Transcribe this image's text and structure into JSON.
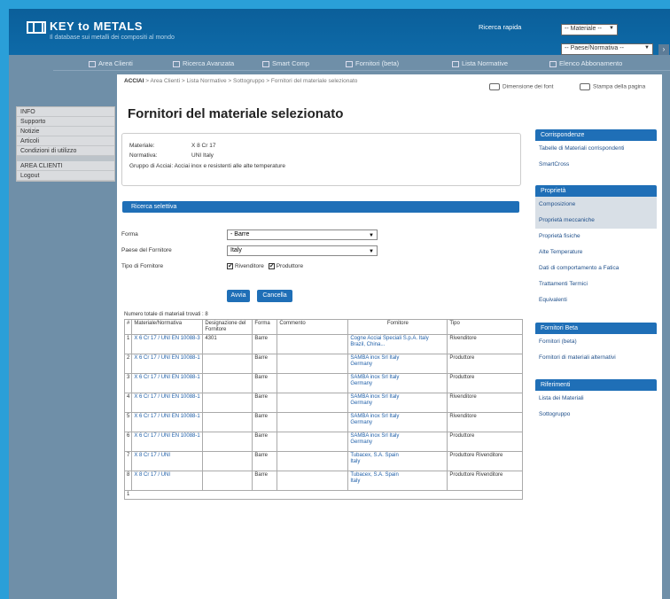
{
  "header": {
    "logo_text": "KEY to METALS",
    "tagline": "Il database sui metalli dei compositi al mondo",
    "quick_search_label": "Ricerca rapida",
    "material_select": "-- Materiale --",
    "country_select": "-- Paese/Normativa --"
  },
  "nav": [
    "Area Clienti",
    "Ricerca Avanzata",
    "Smart Comp",
    "Fornitori (beta)",
    "Lista Normative",
    "Elenco Abbonamento"
  ],
  "sidebar": {
    "group1": [
      "INFO",
      "Supporto",
      "Notizie",
      "Articoli",
      "Condizioni di utilizzo"
    ],
    "group2": [
      "AREA CLIENTI",
      "Logout"
    ]
  },
  "breadcrumb": {
    "bold": "ACCIAI",
    "rest": "> Area Clienti > Lista Normative > Sottogruppo > Fornitori del materiale selezionato"
  },
  "tools": {
    "fonts": "Dimensione dei font",
    "print": "Stampa della pagina"
  },
  "page_title": "Fornitori del materiale selezionato",
  "info": {
    "material_label": "Materiale:",
    "material_value": "X 8 Cr 17",
    "standard_label": "Normativa:",
    "standard_value": "UNI Italy",
    "description": "Gruppo di Acciai: Acciai inox e resistenti alle alte temperature"
  },
  "search": {
    "title": "Ricerca selettiva",
    "form_label": "Forma",
    "form_value": "- Barre",
    "country_label": "Paese del Fornitore",
    "country_value": "Italy",
    "type_label": "Tipo di Fornitore",
    "opt1": "Rivenditore",
    "opt2": "Produttore",
    "search_btn": "Avvia",
    "reset_btn": "Cancella"
  },
  "results_count": "Numero totale di materiali trovati : 8",
  "table": {
    "headers": [
      "#",
      "Materiale/Normativa",
      "Designazione del Fornitore",
      "Forma",
      "Commento",
      "Fornitore",
      "Tipo"
    ],
    "rows": [
      {
        "n": "1",
        "mat": "X 6 Cr 17 / UNI EN 10088-3",
        "des": "4301",
        "form": "Barre",
        "comm": "",
        "supp": "Cogne Acciai Speciali S.p.A. Italy",
        "supp2": "Brazil, China...",
        "type": "Rivenditore"
      },
      {
        "n": "2",
        "mat": "X 6 Cr 17 / UNI EN 10088-1",
        "des": "",
        "form": "Barre",
        "comm": "",
        "supp": "SAMBA inox Srl Italy",
        "supp2": "Germany",
        "type": "Produttore"
      },
      {
        "n": "3",
        "mat": "X 6 Cr 17 / UNI EN 10088-1",
        "des": "",
        "form": "Barre",
        "comm": "",
        "supp": "SAMBA inox Srl Italy",
        "supp2": "Germany",
        "type": "Produttore"
      },
      {
        "n": "4",
        "mat": "X 6 Cr 17 / UNI EN 10088-1",
        "des": "",
        "form": "Barre",
        "comm": "",
        "supp": "SAMBA inox Srl Italy",
        "supp2": "Germany",
        "type": "Rivenditore"
      },
      {
        "n": "5",
        "mat": "X 6 Cr 17 / UNI EN 10088-1",
        "des": "",
        "form": "Barre",
        "comm": "",
        "supp": "SAMBA inox Srl Italy",
        "supp2": "Germany",
        "type": "Rivenditore"
      },
      {
        "n": "6",
        "mat": "X 6 Cr 17 / UNI EN 10088-1",
        "des": "",
        "form": "Barre",
        "comm": "",
        "supp": "SAMBA inox Srl Italy",
        "supp2": "Germany",
        "type": "Produttore"
      },
      {
        "n": "7",
        "mat": "X 8 Cr 17 / UNI",
        "des": "",
        "form": "Barre",
        "comm": "",
        "supp": "Tubacex, S.A. Spain",
        "supp2": "Italy",
        "type": "Produttore Rivenditore"
      },
      {
        "n": "8",
        "mat": "X 8 Cr 17 / UNI",
        "des": "",
        "form": "Barre",
        "comm": "",
        "supp": "Tubacex, S.A. Spain",
        "supp2": "Italy",
        "type": "Produttore Rivenditore"
      }
    ],
    "footer": "1"
  },
  "right": {
    "corr": {
      "title": "Corrispondenze",
      "items": [
        "Tabelle di Materiali corrispondenti",
        "SmartCross"
      ]
    },
    "prop": {
      "title": "Proprietà",
      "items": [
        "Composizione",
        "Proprietà meccaniche",
        "Proprietà fisiche",
        "Alte Temperature",
        "Dati di comportamento a Fatica",
        "Trattamenti Termici",
        "Equivalenti"
      ]
    },
    "supp": {
      "title": "Fornitori Beta",
      "items": [
        "Fornitori (beta)",
        "Fornitori di materiali alternativi"
      ]
    },
    "links": {
      "title": "Riferimenti",
      "items": [
        "Lista dei Materiali",
        "Sottogruppo"
      ]
    }
  }
}
